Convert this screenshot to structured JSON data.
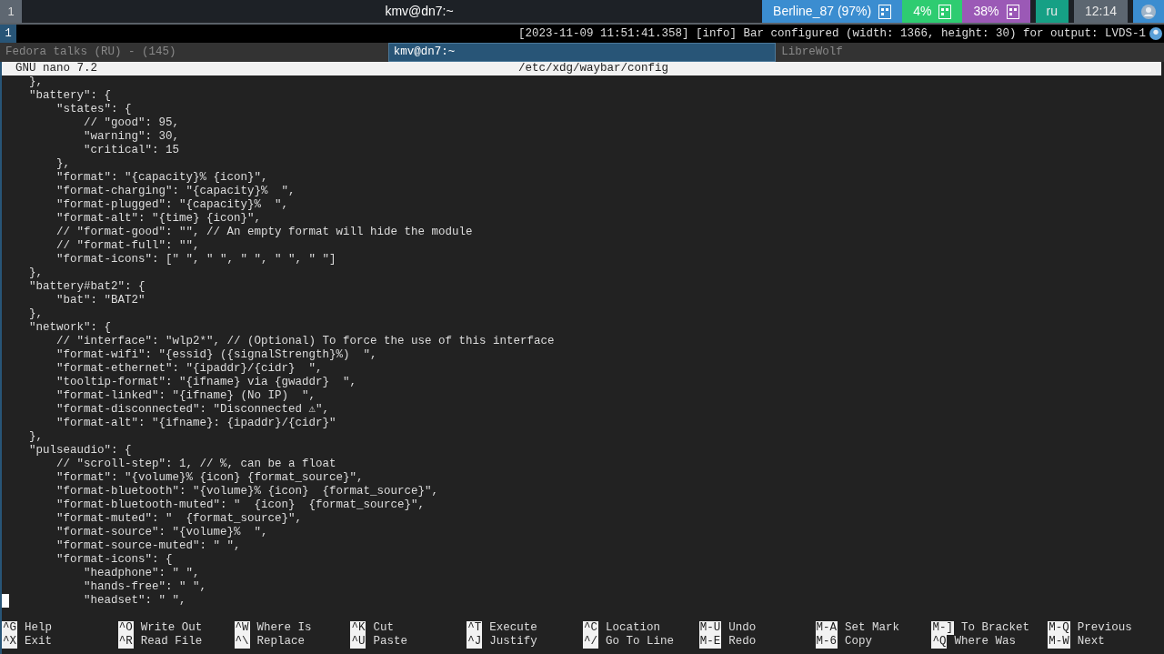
{
  "top_bar": {
    "workspaces": [
      {
        "label": "1",
        "selected": true
      }
    ],
    "title": "kmv@dn7:~",
    "status_blocks": [
      {
        "kind": "text_icon",
        "text": "Berline_87 (97%)",
        "color": "#3b8dd0"
      },
      {
        "kind": "text_icon",
        "text": "4%",
        "color": "#2ecc71"
      },
      {
        "kind": "text_icon",
        "text": "38%",
        "color": "#9b59b6"
      },
      {
        "kind": "text",
        "text": "ru",
        "color": "#16a085"
      },
      {
        "kind": "text",
        "text": "12:14",
        "color": "#5c6670"
      },
      {
        "kind": "tray",
        "color": "#3b8dd0"
      }
    ]
  },
  "log_bar": {
    "workspaces": [
      {
        "label": "1",
        "selected": true
      }
    ],
    "message": "[2023-11-09 11:51:41.358] [info] Bar configured (width: 1366, height: 30) for output: LVDS-1"
  },
  "window_tabs": [
    {
      "label": "Fedora talks (RU) - (145)",
      "selected": false
    },
    {
      "label": "kmv@dn7:~",
      "selected": true
    },
    {
      "label": "LibreWolf",
      "selected": false
    }
  ],
  "nano": {
    "version": "GNU nano 7.2",
    "file": "/etc/xdg/waybar/config",
    "lines": [
      {
        "text": "    },",
        "cursor": false
      },
      {
        "text": "    \"battery\": {",
        "cursor": false
      },
      {
        "text": "        \"states\": {",
        "cursor": false
      },
      {
        "text": "            // \"good\": 95,",
        "cursor": false
      },
      {
        "text": "            \"warning\": 30,",
        "cursor": false
      },
      {
        "text": "            \"critical\": 15",
        "cursor": false
      },
      {
        "text": "        },",
        "cursor": false
      },
      {
        "text": "        \"format\": \"{capacity}% {icon}\",",
        "cursor": false
      },
      {
        "text": "        \"format-charging\": \"{capacity}%  \",",
        "cursor": false
      },
      {
        "text": "        \"format-plugged\": \"{capacity}%  \",",
        "cursor": false
      },
      {
        "text": "        \"format-alt\": \"{time} {icon}\",",
        "cursor": false
      },
      {
        "text": "        // \"format-good\": \"\", // An empty format will hide the module",
        "cursor": false
      },
      {
        "text": "        // \"format-full\": \"\",",
        "cursor": false
      },
      {
        "text": "        \"format-icons\": [\" \", \" \", \" \", \" \", \" \"]",
        "cursor": false
      },
      {
        "text": "    },",
        "cursor": false
      },
      {
        "text": "    \"battery#bat2\": {",
        "cursor": false
      },
      {
        "text": "        \"bat\": \"BAT2\"",
        "cursor": false
      },
      {
        "text": "    },",
        "cursor": false
      },
      {
        "text": "    \"network\": {",
        "cursor": false
      },
      {
        "text": "        // \"interface\": \"wlp2*\", // (Optional) To force the use of this interface",
        "cursor": false
      },
      {
        "text": "        \"format-wifi\": \"{essid} ({signalStrength}%)  \",",
        "cursor": false
      },
      {
        "text": "        \"format-ethernet\": \"{ipaddr}/{cidr}  \",",
        "cursor": false
      },
      {
        "text": "        \"tooltip-format\": \"{ifname} via {gwaddr}  \",",
        "cursor": false
      },
      {
        "text": "        \"format-linked\": \"{ifname} (No IP)  \",",
        "cursor": false
      },
      {
        "text": "        \"format-disconnected\": \"Disconnected ⚠\",",
        "cursor": false
      },
      {
        "text": "        \"format-alt\": \"{ifname}: {ipaddr}/{cidr}\"",
        "cursor": false
      },
      {
        "text": "    },",
        "cursor": false
      },
      {
        "text": "    \"pulseaudio\": {",
        "cursor": false
      },
      {
        "text": "        // \"scroll-step\": 1, // %, can be a float",
        "cursor": false
      },
      {
        "text": "        \"format\": \"{volume}% {icon} {format_source}\",",
        "cursor": false
      },
      {
        "text": "        \"format-bluetooth\": \"{volume}% {icon}  {format_source}\",",
        "cursor": false
      },
      {
        "text": "        \"format-bluetooth-muted\": \"  {icon}  {format_source}\",",
        "cursor": false
      },
      {
        "text": "        \"format-muted\": \"  {format_source}\",",
        "cursor": false
      },
      {
        "text": "        \"format-source\": \"{volume}%  \",",
        "cursor": false
      },
      {
        "text": "        \"format-source-muted\": \" \",",
        "cursor": false
      },
      {
        "text": "        \"format-icons\": {",
        "cursor": false
      },
      {
        "text": "            \"headphone\": \" \",",
        "cursor": false
      },
      {
        "text": "            \"hands-free\": \" \",",
        "cursor": false
      },
      {
        "text": "            \"headset\": \" \",",
        "cursor": true
      }
    ],
    "shortcut_rows": [
      [
        {
          "key": "^G",
          "label": "Help"
        },
        {
          "key": "^O",
          "label": "Write Out"
        },
        {
          "key": "^W",
          "label": "Where Is"
        },
        {
          "key": "^K",
          "label": "Cut"
        },
        {
          "key": "^T",
          "label": "Execute"
        },
        {
          "key": "^C",
          "label": "Location"
        },
        {
          "key": "M-U",
          "label": "Undo"
        },
        {
          "key": "M-A",
          "label": "Set Mark"
        },
        {
          "key": "M-]",
          "label": "To Bracket"
        },
        {
          "key": "M-Q",
          "label": "Previous"
        }
      ],
      [
        {
          "key": "^X",
          "label": "Exit"
        },
        {
          "key": "^R",
          "label": "Read File"
        },
        {
          "key": "^\\",
          "label": "Replace"
        },
        {
          "key": "^U",
          "label": "Paste"
        },
        {
          "key": "^J",
          "label": "Justify"
        },
        {
          "key": "^/",
          "label": "Go To Line"
        },
        {
          "key": "M-E",
          "label": "Redo"
        },
        {
          "key": "M-6",
          "label": "Copy"
        },
        {
          "key": "^Q",
          "label": "Where Was"
        },
        {
          "key": "M-W",
          "label": "Next"
        }
      ]
    ]
  }
}
